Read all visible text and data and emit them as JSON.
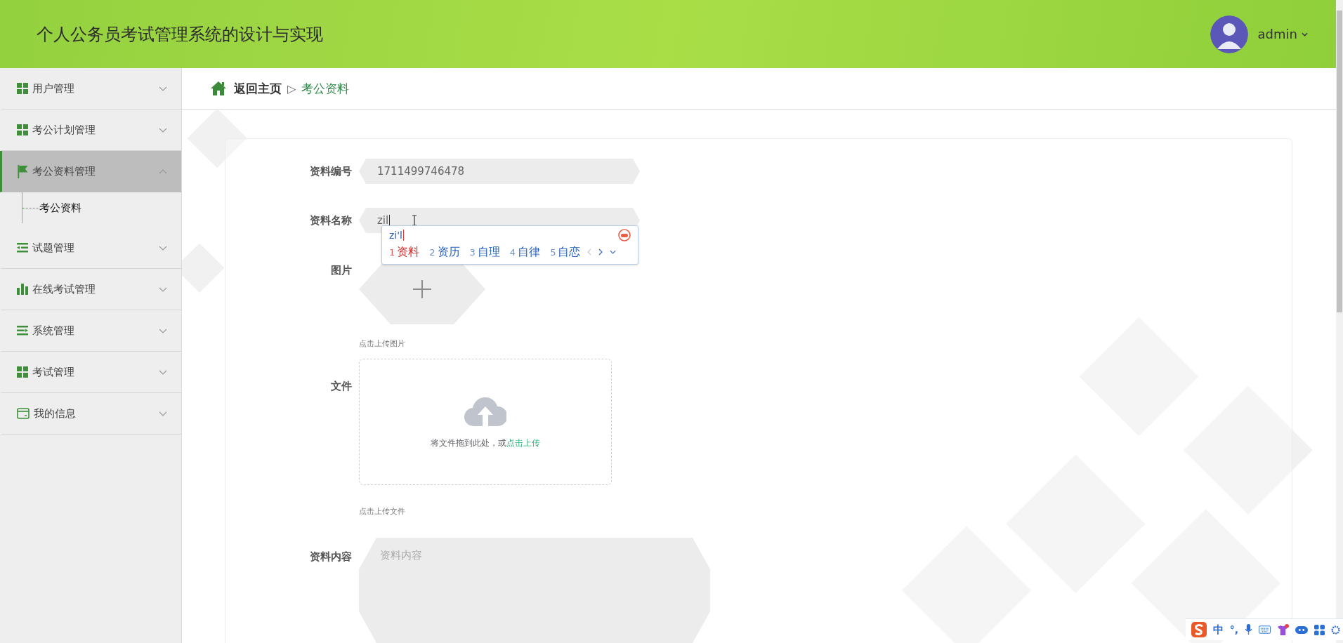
{
  "header": {
    "title": "个人公务员考试管理系统的设计与实现",
    "user": "admin"
  },
  "sidebar": {
    "items": [
      {
        "label": "用户管理",
        "kind": "grid",
        "expanded": false,
        "selected": false
      },
      {
        "label": "考公计划管理",
        "kind": "grid",
        "expanded": false,
        "selected": false
      },
      {
        "label": "考公资料管理",
        "kind": "flag",
        "expanded": true,
        "selected": true,
        "children": [
          {
            "label": "考公资料"
          }
        ]
      },
      {
        "label": "试题管理",
        "kind": "list",
        "expanded": false,
        "selected": false
      },
      {
        "label": "在线考试管理",
        "kind": "chart",
        "expanded": false,
        "selected": false
      },
      {
        "label": "系统管理",
        "kind": "menu",
        "expanded": false,
        "selected": false
      },
      {
        "label": "考试管理",
        "kind": "grid",
        "expanded": false,
        "selected": false
      },
      {
        "label": "我的信息",
        "kind": "card",
        "expanded": false,
        "selected": false
      }
    ]
  },
  "breadcrumb": {
    "home": "返回主页",
    "separator": "▷",
    "current": "考公资料"
  },
  "form": {
    "fields": [
      {
        "label": "资料编号",
        "kind": "text",
        "value": "1711499746478"
      },
      {
        "label": "资料名称",
        "kind": "text",
        "value": "zil"
      },
      {
        "label": "图片",
        "kind": "image",
        "hint": "点击上传图片"
      },
      {
        "label": "文件",
        "kind": "file",
        "drop_text": "将文件拖到此处，或",
        "drop_link": "点击上传",
        "hint": "点击上传文件"
      },
      {
        "label": "资料内容",
        "kind": "textarea",
        "placeholder": "资料内容"
      }
    ]
  },
  "ime": {
    "composition": "zi'l",
    "candidates": [
      {
        "number": "1",
        "text": "资料",
        "selected": true
      },
      {
        "number": "2",
        "text": "资历",
        "selected": false
      },
      {
        "number": "3",
        "text": "自理",
        "selected": false
      },
      {
        "number": "4",
        "text": "自律",
        "selected": false
      },
      {
        "number": "5",
        "text": "自恋",
        "selected": false
      }
    ]
  },
  "ime_toolbar": {
    "mode": "中",
    "punctuation": "°,"
  }
}
